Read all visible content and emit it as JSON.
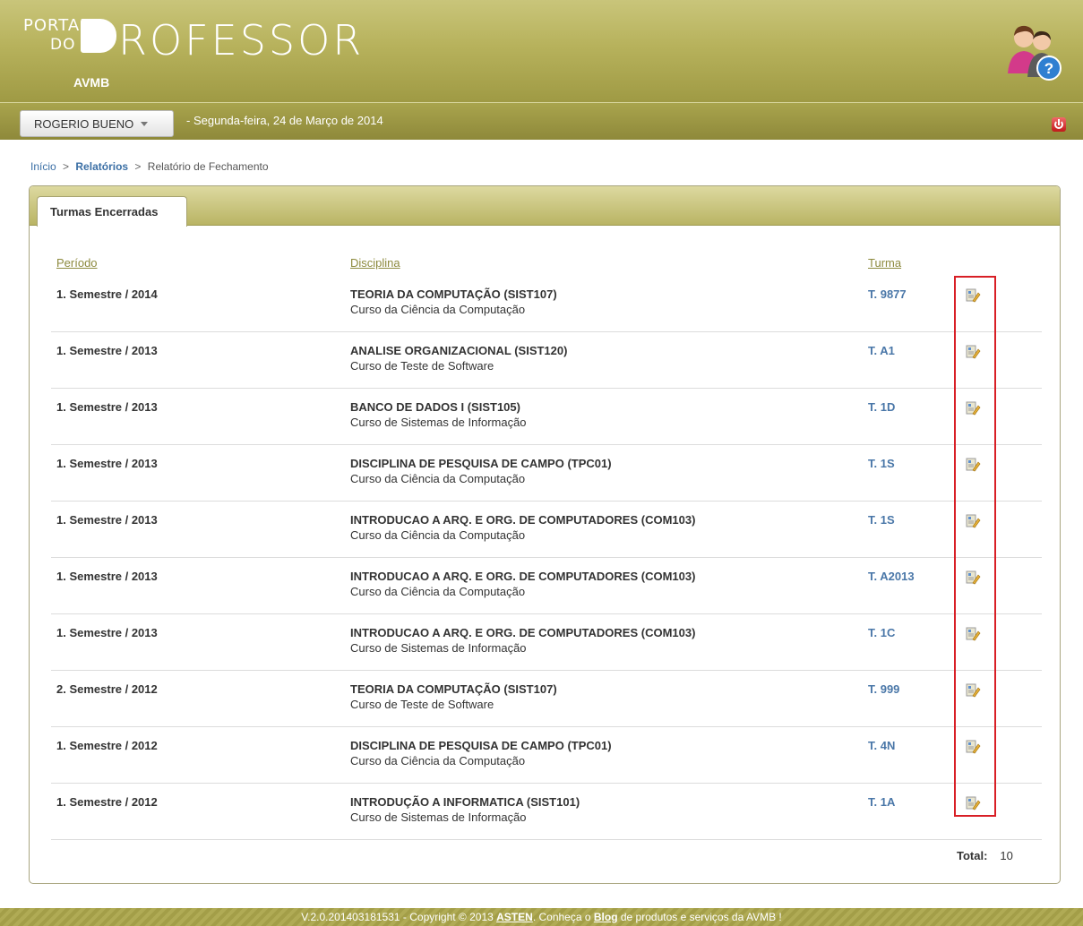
{
  "header": {
    "logo_small": "PORTAL",
    "logo_do": "DO",
    "logo_big": "ROFESSOR",
    "org": "AVMB"
  },
  "userbar": {
    "user": "ROGERIO BUENO",
    "date": "- Segunda-feira, 24 de Março de 2014"
  },
  "breadcrumb": {
    "home": "Início",
    "reports": "Relatórios",
    "current": "Relatório de Fechamento",
    "separator": ">"
  },
  "tab": {
    "label": "Turmas Encerradas"
  },
  "table": {
    "headers": {
      "periodo": "Período",
      "disciplina": "Disciplina",
      "turma": "Turma"
    },
    "rows": [
      {
        "periodo": "1. Semestre / 2014",
        "disciplina": "TEORIA DA COMPUTAÇÃO (SIST107)",
        "curso": "Curso da Ciência da Computação",
        "turma": "T. 9877"
      },
      {
        "periodo": "1. Semestre / 2013",
        "disciplina": "ANALISE ORGANIZACIONAL (SIST120)",
        "curso": "Curso de Teste de Software",
        "turma": "T. A1"
      },
      {
        "periodo": "1. Semestre / 2013",
        "disciplina": "BANCO DE DADOS I (SIST105)",
        "curso": "Curso de Sistemas de Informação",
        "turma": "T. 1D"
      },
      {
        "periodo": "1. Semestre / 2013",
        "disciplina": "DISCIPLINA DE PESQUISA DE CAMPO (TPC01)",
        "curso": "Curso da Ciência da Computação",
        "turma": "T. 1S"
      },
      {
        "periodo": "1. Semestre / 2013",
        "disciplina": "INTRODUCAO A ARQ. E ORG. DE COMPUTADORES (COM103)",
        "curso": "Curso da Ciência da Computação",
        "turma": "T. 1S"
      },
      {
        "periodo": "1. Semestre / 2013",
        "disciplina": "INTRODUCAO A ARQ. E ORG. DE COMPUTADORES (COM103)",
        "curso": "Curso da Ciência da Computação",
        "turma": "T. A2013"
      },
      {
        "periodo": "1. Semestre / 2013",
        "disciplina": "INTRODUCAO A ARQ. E ORG. DE COMPUTADORES (COM103)",
        "curso": "Curso de Sistemas de Informação",
        "turma": "T. 1C"
      },
      {
        "periodo": "2. Semestre / 2012",
        "disciplina": "TEORIA DA COMPUTAÇÃO (SIST107)",
        "curso": "Curso de Teste de Software",
        "turma": "T. 999"
      },
      {
        "periodo": "1. Semestre / 2012",
        "disciplina": "DISCIPLINA DE PESQUISA DE CAMPO (TPC01)",
        "curso": "Curso da Ciência da Computação",
        "turma": "T. 4N"
      },
      {
        "periodo": "1. Semestre / 2012",
        "disciplina": "INTRODUÇÃO A INFORMATICA (SIST101)",
        "curso": "Curso de Sistemas de Informação",
        "turma": "T. 1A"
      }
    ],
    "row_icon": "report-edit-icon"
  },
  "total": {
    "label": "Total:",
    "value": "10"
  },
  "footer": {
    "prefix": "V.2.0.201403181531 - Copyright © 2013 ",
    "asten": "ASTEN",
    "middle": ". Conheça o ",
    "blog": "Blog",
    "suffix": " de produtos e serviços da AVMB !"
  },
  "colors": {
    "header_olive": "#b7b25c",
    "link_blue": "#3b6fa5",
    "highlight_red": "#d81f26"
  }
}
